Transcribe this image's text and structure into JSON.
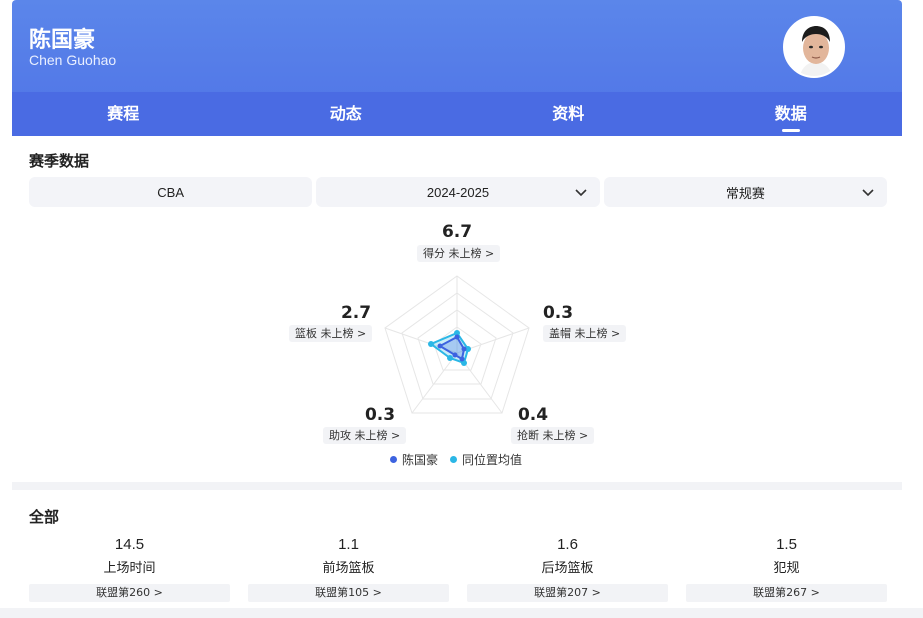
{
  "player": {
    "name_cn": "陈国豪",
    "name_en": "Chen Guohao"
  },
  "tabs": [
    {
      "label": "赛程"
    },
    {
      "label": "动态"
    },
    {
      "label": "资料"
    },
    {
      "label": "数据",
      "active": true
    }
  ],
  "season_section": {
    "title": "赛季数据",
    "filters": {
      "league": "CBA",
      "season": "2024-2025",
      "type": "常规赛"
    }
  },
  "radar": {
    "stats": [
      {
        "value": "6.7",
        "label": "得分 未上榜 >"
      },
      {
        "value": "0.3",
        "label": "盖帽 未上榜 >"
      },
      {
        "value": "0.4",
        "label": "抢断 未上榜 >"
      },
      {
        "value": "0.3",
        "label": "助攻 未上榜 >"
      },
      {
        "value": "2.7",
        "label": "篮板 未上榜 >"
      }
    ],
    "legend": [
      {
        "label": "陈国豪",
        "color": "#3d63e0"
      },
      {
        "label": "同位置均值",
        "color": "#2bb7e6"
      }
    ]
  },
  "all_section": {
    "title": "全部",
    "items": [
      {
        "value": "14.5",
        "label": "上场时间",
        "rank": "联盟第260 >"
      },
      {
        "value": "1.1",
        "label": "前场篮板",
        "rank": "联盟第105 >"
      },
      {
        "value": "1.6",
        "label": "后场篮板",
        "rank": "联盟第207 >"
      },
      {
        "value": "1.5",
        "label": "犯规",
        "rank": "联盟第267 >"
      }
    ]
  },
  "colors": {
    "header": "#4f73e6",
    "tab_bar": "#4a6be3",
    "player_series": "#3d63e0",
    "avg_series": "#2bb7e6"
  },
  "icons": [
    "chevron-down-icon",
    "avatar-photo"
  ]
}
